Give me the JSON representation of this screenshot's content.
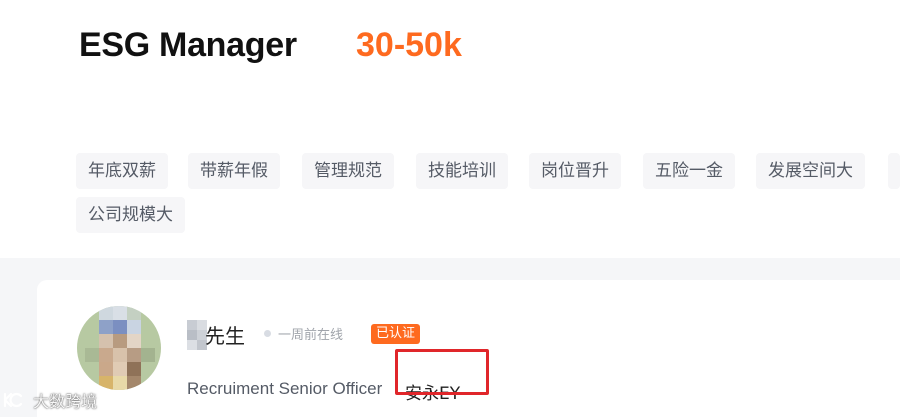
{
  "job": {
    "title": "ESG Manager",
    "salary": "30-50k",
    "tags": [
      "年底双薪",
      "带薪年假",
      "管理规范",
      "技能培训",
      "岗位晋升",
      "五险一金",
      "发展空间大",
      "公司规模大"
    ]
  },
  "recruiter": {
    "name_suffix": "先生",
    "online_status": "一周前在线",
    "verified_badge": "已认证",
    "role": "Recruiment Senior Officer",
    "company": "安永EY"
  },
  "watermark": {
    "text": "大数跨境"
  },
  "colors": {
    "accent": "#fe6a1f",
    "highlight": "#e0262a",
    "tag_bg": "#f6f6f8",
    "section_bg": "#f5f6f8"
  }
}
